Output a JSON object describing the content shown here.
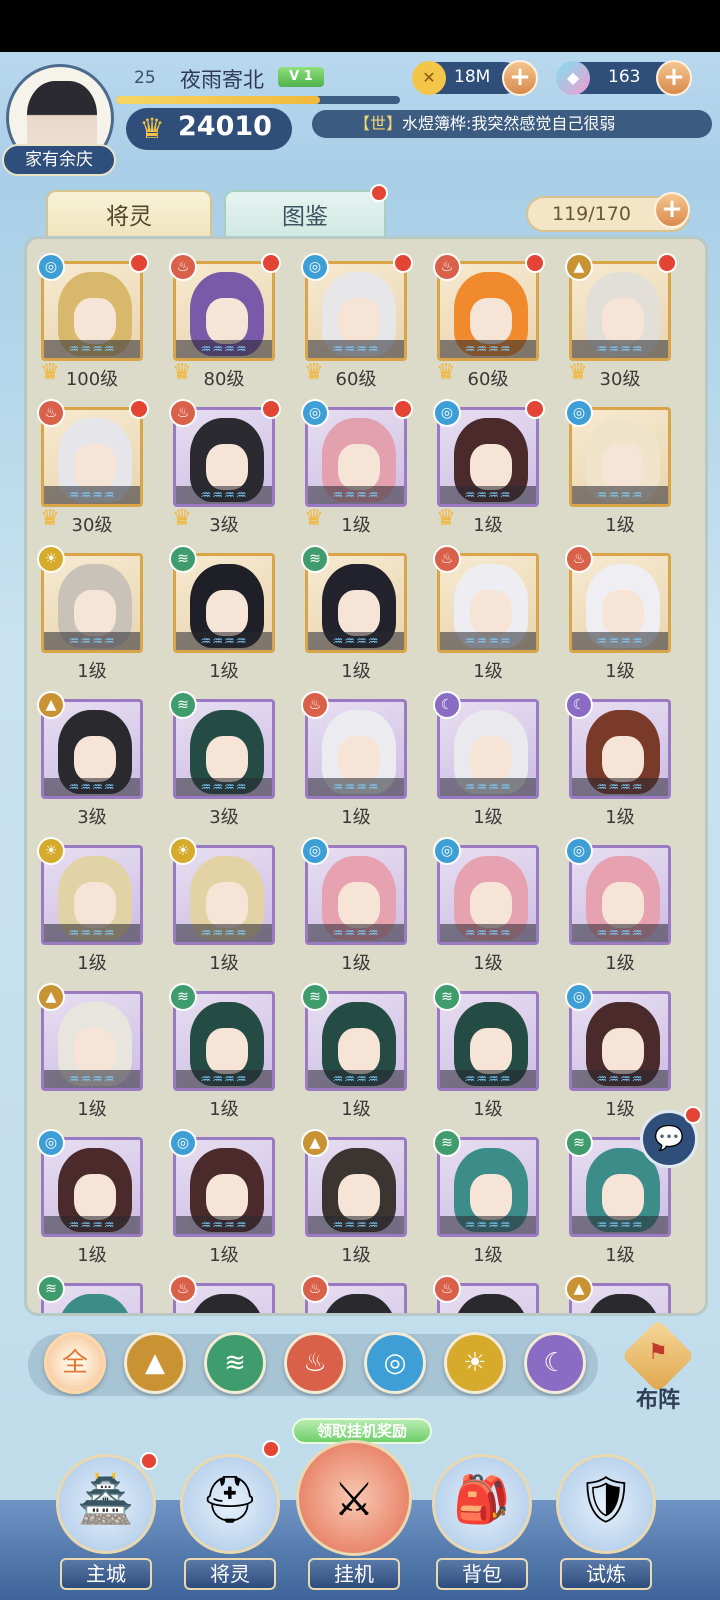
{
  "player": {
    "level": "25",
    "name": "夜雨寄北",
    "vip": "V 1",
    "xp_fraction": 0.72,
    "title": "家有余庆",
    "power": "24010"
  },
  "resources": {
    "gold": "18M",
    "gems": "163"
  },
  "chat": {
    "channel": "【世】",
    "message": "水煜簿桦:我突然感觉自己很弱"
  },
  "tabs": {
    "heroes": "将灵",
    "codex": "图鉴"
  },
  "capacity": "119/170",
  "heroes": [
    {
      "level": "100级",
      "element": "water",
      "quality": "gold",
      "hair": "#d8b86a",
      "badge": true,
      "dot": true
    },
    {
      "level": "80级",
      "element": "fire",
      "quality": "gold",
      "hair": "#7a5aa8",
      "badge": true,
      "dot": true
    },
    {
      "level": "60级",
      "element": "water",
      "quality": "gold",
      "hair": "#e7e7ea",
      "badge": true,
      "dot": true
    },
    {
      "level": "60级",
      "element": "fire",
      "quality": "gold",
      "hair": "#f08a2c",
      "badge": true,
      "dot": true
    },
    {
      "level": "30级",
      "element": "earth",
      "quality": "gold",
      "hair": "#e2dfd8",
      "badge": true,
      "dot": true
    },
    {
      "level": "30级",
      "element": "fire",
      "quality": "gold",
      "hair": "#e5e5ea",
      "badge": true,
      "dot": true
    },
    {
      "level": "3级",
      "element": "fire",
      "quality": "purple",
      "hair": "#2a2a30",
      "badge": true,
      "dot": true
    },
    {
      "level": "1级",
      "element": "water",
      "quality": "purple",
      "hair": "#e3a0ae",
      "badge": true,
      "dot": true
    },
    {
      "level": "1级",
      "element": "water",
      "quality": "purple",
      "hair": "#4a2a2a",
      "badge": true,
      "dot": true
    },
    {
      "level": "1级",
      "element": "water",
      "quality": "gold",
      "hair": "#efe3c9",
      "badge": false,
      "dot": false
    },
    {
      "level": "1级",
      "element": "light",
      "quality": "gold",
      "hair": "#c9c2b8",
      "badge": false,
      "dot": false
    },
    {
      "level": "1级",
      "element": "wind",
      "quality": "gold",
      "hair": "#1f1f28",
      "badge": false,
      "dot": false
    },
    {
      "level": "1级",
      "element": "wind",
      "quality": "gold",
      "hair": "#22222c",
      "badge": false,
      "dot": false
    },
    {
      "level": "1级",
      "element": "fire",
      "quality": "gold",
      "hair": "#eeeef2",
      "badge": false,
      "dot": false
    },
    {
      "level": "1级",
      "element": "fire",
      "quality": "gold",
      "hair": "#efeff3",
      "badge": false,
      "dot": false
    },
    {
      "level": "3级",
      "element": "earth",
      "quality": "purple",
      "hair": "#2a2a2e",
      "badge": false,
      "dot": false
    },
    {
      "level": "3级",
      "element": "wind",
      "quality": "purple",
      "hair": "#254c44",
      "badge": false,
      "dot": false
    },
    {
      "level": "1级",
      "element": "fire",
      "quality": "purple",
      "hair": "#ececf0",
      "badge": false,
      "dot": false
    },
    {
      "level": "1级",
      "element": "dark",
      "quality": "purple",
      "hair": "#e9e9ee",
      "badge": false,
      "dot": false
    },
    {
      "level": "1级",
      "element": "dark",
      "quality": "purple",
      "hair": "#7a3a2a",
      "badge": false,
      "dot": false
    },
    {
      "level": "1级",
      "element": "light",
      "quality": "purple",
      "hair": "#e2d3a6",
      "badge": false,
      "dot": false
    },
    {
      "level": "1级",
      "element": "light",
      "quality": "purple",
      "hair": "#e3d3a4",
      "badge": false,
      "dot": false
    },
    {
      "level": "1级",
      "element": "water",
      "quality": "purple",
      "hair": "#e6a2b0",
      "badge": false,
      "dot": false
    },
    {
      "level": "1级",
      "element": "water",
      "quality": "purple",
      "hair": "#e6a2b0",
      "badge": false,
      "dot": false
    },
    {
      "level": "1级",
      "element": "water",
      "quality": "purple",
      "hair": "#e6a2b0",
      "badge": false,
      "dot": false
    },
    {
      "level": "1级",
      "element": "earth",
      "quality": "purple",
      "hair": "#e8e5df",
      "badge": false,
      "dot": false
    },
    {
      "level": "1级",
      "element": "wind",
      "quality": "purple",
      "hair": "#244b44",
      "badge": false,
      "dot": false
    },
    {
      "level": "1级",
      "element": "wind",
      "quality": "purple",
      "hair": "#244b44",
      "badge": false,
      "dot": false
    },
    {
      "level": "1级",
      "element": "wind",
      "quality": "purple",
      "hair": "#244b44",
      "badge": false,
      "dot": false
    },
    {
      "level": "1级",
      "element": "water",
      "quality": "purple",
      "hair": "#4a2a2a",
      "badge": false,
      "dot": false
    },
    {
      "level": "1级",
      "element": "water",
      "quality": "purple",
      "hair": "#4a2a2a",
      "badge": false,
      "dot": false
    },
    {
      "level": "1级",
      "element": "water",
      "quality": "purple",
      "hair": "#4a2a2a",
      "badge": false,
      "dot": false
    },
    {
      "level": "1级",
      "element": "earth",
      "quality": "purple",
      "hair": "#3a3530",
      "badge": false,
      "dot": false
    },
    {
      "level": "1级",
      "element": "wind",
      "quality": "purple",
      "hair": "#3c8c8a",
      "badge": false,
      "dot": false
    },
    {
      "level": "1级",
      "element": "wind",
      "quality": "purple",
      "hair": "#3c8c8a",
      "badge": false,
      "dot": false
    },
    {
      "level": "",
      "element": "wind",
      "quality": "purple",
      "hair": "#3c8c8a",
      "badge": false,
      "dot": false
    },
    {
      "level": "",
      "element": "fire",
      "quality": "purple",
      "hair": "#2a2a2e",
      "badge": false,
      "dot": false
    },
    {
      "level": "",
      "element": "fire",
      "quality": "purple",
      "hair": "#2a2a2e",
      "badge": false,
      "dot": false
    },
    {
      "level": "",
      "element": "fire",
      "quality": "purple",
      "hair": "#2a2a2e",
      "badge": false,
      "dot": false
    },
    {
      "level": "",
      "element": "earth",
      "quality": "purple",
      "hair": "#2a2a2e",
      "badge": false,
      "dot": false
    }
  ],
  "filters": {
    "all": "全",
    "items": [
      "earth",
      "wind",
      "fire",
      "water",
      "light",
      "dark"
    ]
  },
  "formation_label": "布阵",
  "idle_banner": "领取挂机奖励",
  "nav": {
    "city": "主城",
    "heroes": "将灵",
    "idle": "挂机",
    "bag": "背包",
    "trial": "试炼"
  },
  "colors": {
    "accent_red": "#e34433",
    "panel_bg": "#dcdac9",
    "nav_bg": "#3e6499"
  }
}
